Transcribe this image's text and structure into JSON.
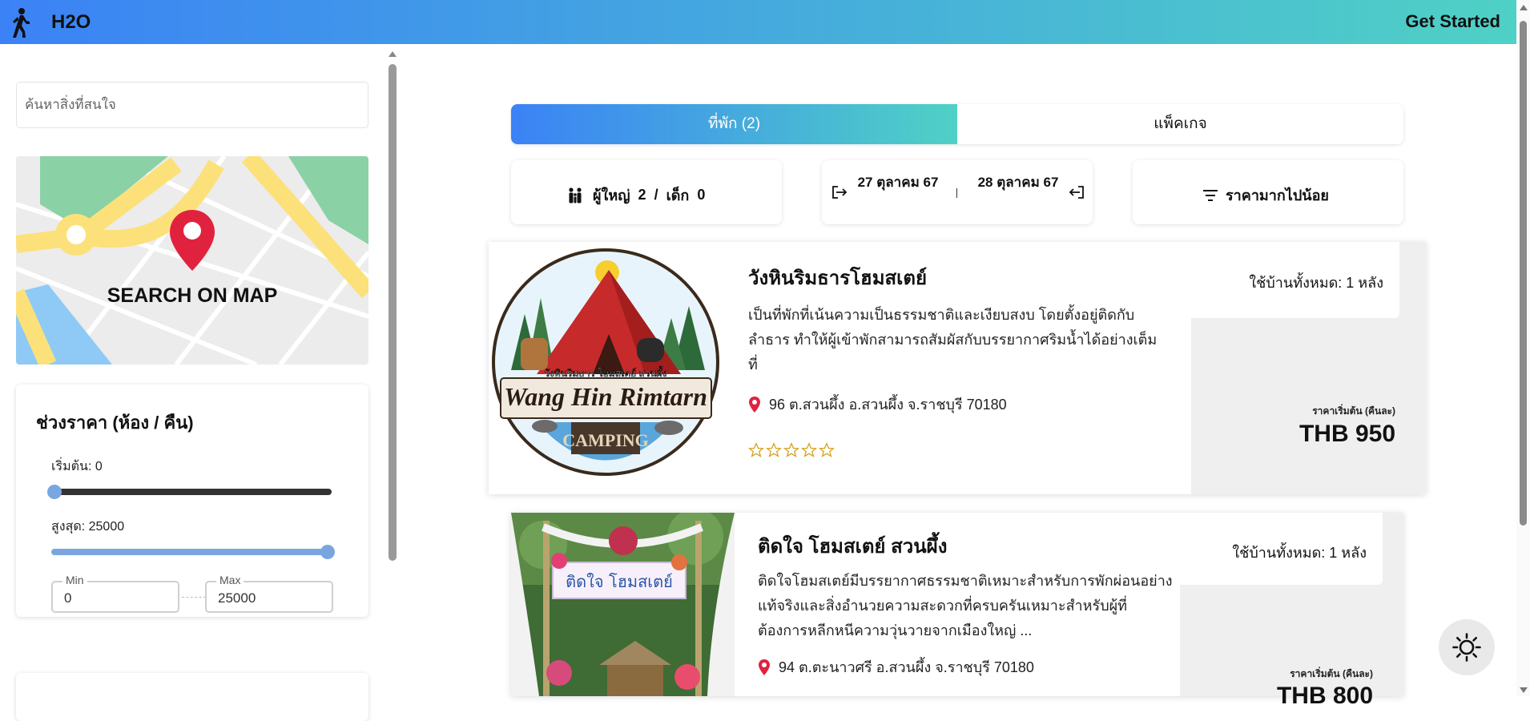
{
  "header": {
    "title": "H2O",
    "cta": "Get Started"
  },
  "sidebar": {
    "search_placeholder": "ค้นหาสิ่งที่สนใจ",
    "map_label": "SEARCH ON MAP",
    "price_filter": {
      "title": "ช่วงราคา (ห้อง / คืน)",
      "min_text": "เริ่มต้น: 0",
      "max_text": "สูงสุด: 25000",
      "min_legend": "Min",
      "max_legend": "Max",
      "min_value": "0",
      "max_value": "25000"
    }
  },
  "tabs": [
    {
      "label": "ที่พัก (2)",
      "active": true
    },
    {
      "label": "แพ็คเกจ",
      "active": false
    }
  ],
  "filters": {
    "guests": {
      "adult_label": "ผู้ใหญ่",
      "adult_count": "2",
      "sep": "/",
      "child_label": "เด็ก",
      "child_count": "0"
    },
    "dates": {
      "check_in": "27 ตุลาคม 67",
      "check_out": "28 ตุลาคม 67"
    },
    "sort": {
      "label": "ราคามากไปน้อย"
    }
  },
  "listings": [
    {
      "name": "วังหินริมธารโฮมสเตย์",
      "description": "เป็นที่พักที่เน้นความเป็นธรรมชาติและเงียบสงบ โดยตั้งอยู่ติดกับลำธาร ทำให้ผู้เข้าพักสามารถสัมผัสกับบรรยากาศริมน้ำได้อย่างเต็มที่",
      "address": "96 ต.สวนผึ้ง อ.สวนผึ้ง จ.ราชบุรี 70180",
      "rating": 0,
      "max_rating": 5,
      "uses": "ใช้บ้านทั้งหมด: 1 หลัง",
      "price_note": "ราคาเริ่มต้น (คืนละ)",
      "price": "THB 950",
      "logo_text_top": "วังหินริมธาร โฮมสเตย์ สวนผึ้ง",
      "logo_text_main": "Wang Hin Rimtarn",
      "logo_text_sub": "CAMPING"
    },
    {
      "name": "ติดใจ โฮมสเตย์ สวนผึ้ง",
      "description": "ติดใจโฮมสเตย์มีบรรยากาศธรรมชาติเหมาะสำหรับการพักผ่อนอย่างแท้จริงและสิ่งอำนวยความสะดวกที่ครบครันเหมาะสำหรับผู้ที่ต้องการหลีกหนีความวุ่นวายจากเมืองใหญ่ ...",
      "address": "94 ต.ตะนาวศรี อ.สวนผึ้ง จ.ราชบุรี 70180",
      "uses": "ใช้บ้านทั้งหมด: 1 หลัง",
      "price_note": "ราคาเริ่มต้น (คืนละ)",
      "price": "THB 800",
      "sign_text": "ติดใจ โฮมสเตย์"
    }
  ],
  "colors": {
    "gradient_start": "#3b82f6",
    "gradient_end": "#4fd1c5",
    "pin": "#e0223f",
    "star": "#d4a017"
  },
  "icons": [
    "walking-person-icon",
    "map-pin-icon",
    "family-icon",
    "check-in-icon",
    "check-out-icon",
    "filter-icon",
    "location-pin-icon",
    "star-outline-icon",
    "sun-icon"
  ]
}
